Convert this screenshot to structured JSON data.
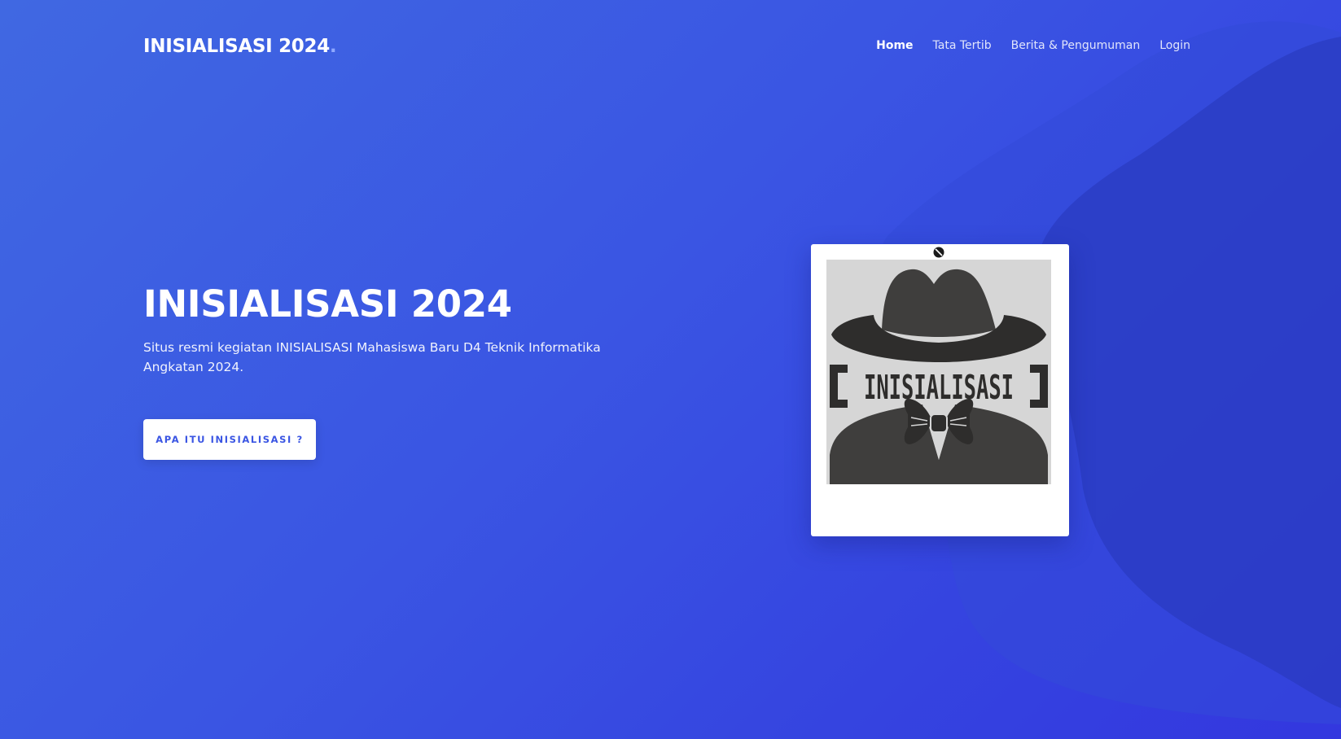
{
  "nav": {
    "brand": "INISIALISASI 2024",
    "brand_dot": ".",
    "links": [
      {
        "label": "Home",
        "active": true
      },
      {
        "label": "Tata Tertib",
        "active": false
      },
      {
        "label": "Berita & Pengumuman",
        "active": false
      },
      {
        "label": "Login",
        "active": false
      }
    ]
  },
  "hero": {
    "title": "INISIALISASI 2024",
    "subtitle": "Situs resmi kegiatan INISIALISASI Mahasiswa Baru D4 Teknik Informatika Angkatan 2024.",
    "button_label": "APA ITU INISIALISASI ?"
  },
  "logo": {
    "text": "INISIALISASI",
    "left_bracket": "[",
    "right_bracket": "]"
  },
  "colors": {
    "accent": "#3a55e3",
    "background_start": "#4068e2",
    "background_end": "#3337df",
    "logo_dark": "#3f3e3d",
    "logo_bg": "#d6d6d6"
  },
  "icons": {
    "pin": "pin-icon"
  }
}
